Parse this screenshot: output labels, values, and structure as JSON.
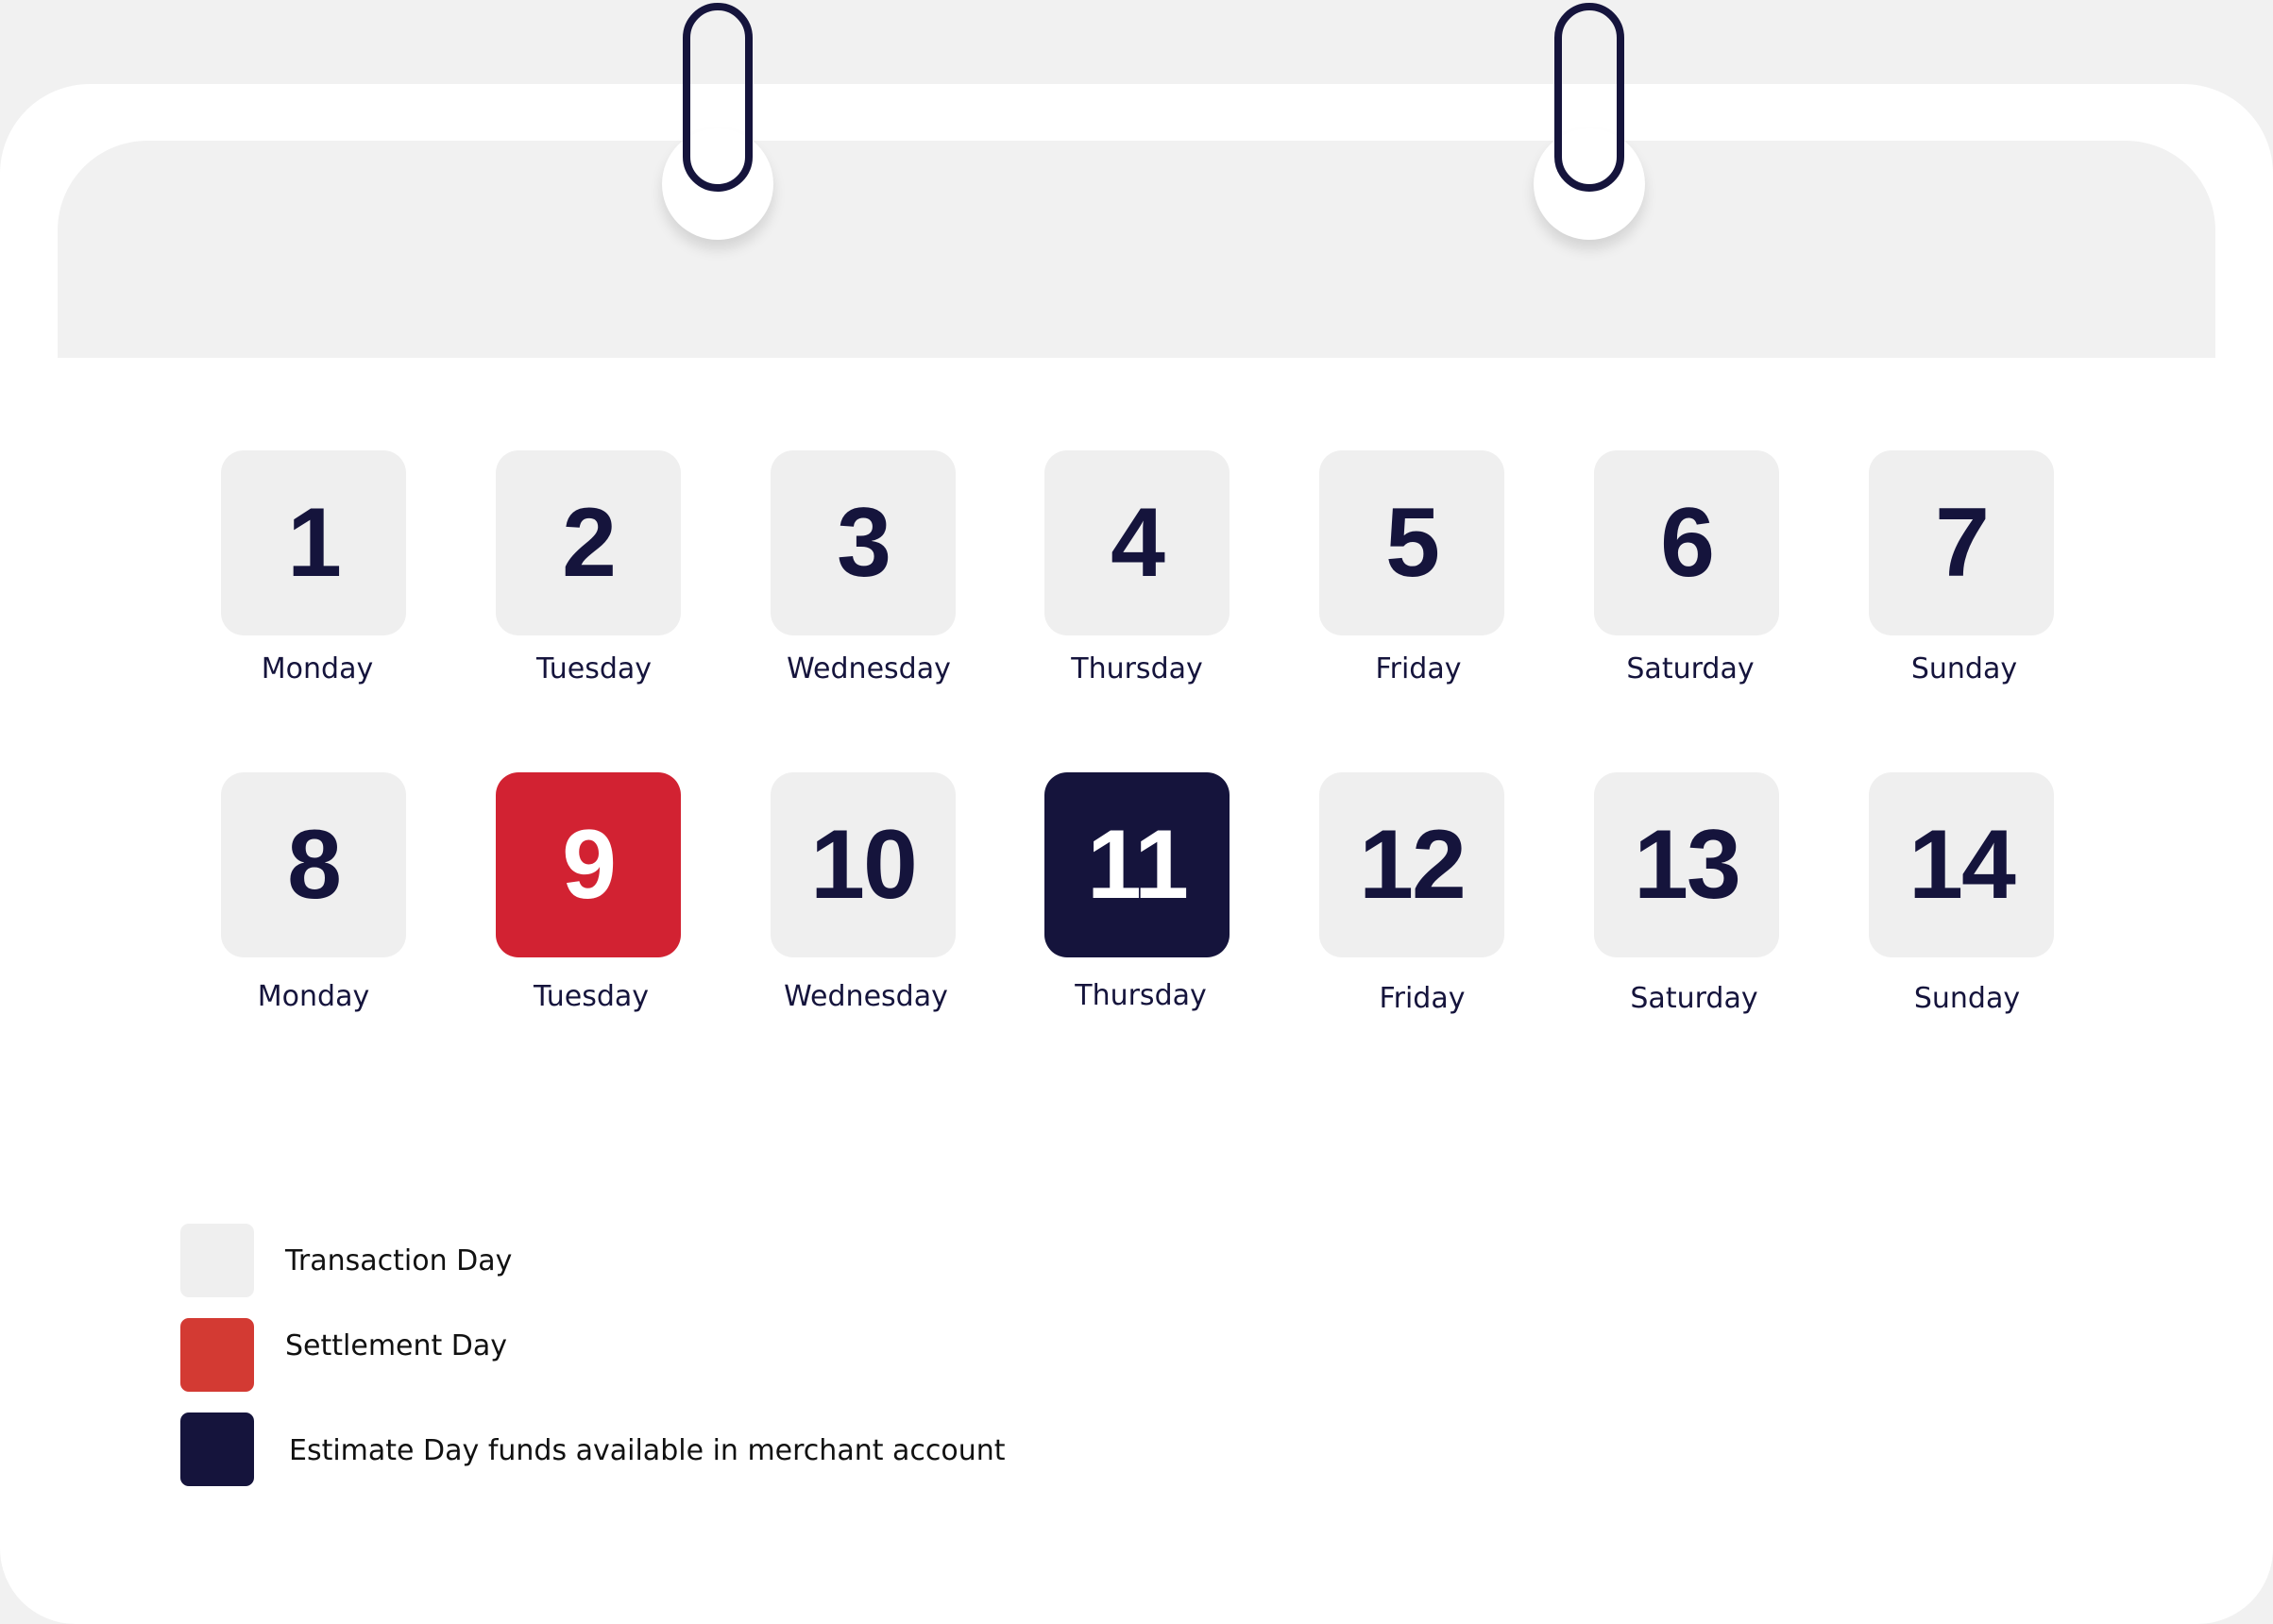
{
  "colors": {
    "background": "#f1f1f1",
    "calendar_body": "#ffffff",
    "transaction": "#efefef",
    "settlement": "#d22232",
    "settlement_swatch": "#d33a33",
    "estimate": "#15143c",
    "text_dark": "#15143c"
  },
  "rings": [
    {
      "icon": "binder-ring-icon"
    },
    {
      "icon": "binder-ring-icon"
    }
  ],
  "weeks": [
    {
      "days": [
        {
          "number": "1",
          "label": "Monday",
          "type": "transaction"
        },
        {
          "number": "2",
          "label": "Tuesday",
          "type": "transaction"
        },
        {
          "number": "3",
          "label": "Wednesday",
          "type": "transaction"
        },
        {
          "number": "4",
          "label": "Thursday",
          "type": "transaction"
        },
        {
          "number": "5",
          "label": "Friday",
          "type": "transaction"
        },
        {
          "number": "6",
          "label": "Saturday",
          "type": "transaction"
        },
        {
          "number": "7",
          "label": "Sunday",
          "type": "transaction"
        }
      ]
    },
    {
      "days": [
        {
          "number": "8",
          "label": "Monday",
          "type": "transaction"
        },
        {
          "number": "9",
          "label": "Tuesday",
          "type": "settlement"
        },
        {
          "number": "10",
          "label": "Wednesday",
          "type": "transaction"
        },
        {
          "number": "11",
          "label": "Thursday",
          "type": "estimate"
        },
        {
          "number": "12",
          "label": "Friday",
          "type": "transaction"
        },
        {
          "number": "13",
          "label": "Saturday",
          "type": "transaction"
        },
        {
          "number": "14",
          "label": "Sunday",
          "type": "transaction"
        }
      ]
    }
  ],
  "legend": {
    "items": [
      {
        "label": "Transaction Day",
        "type": "transaction"
      },
      {
        "label": "Settlement Day",
        "type": "settlement"
      },
      {
        "label": "Estimate Day funds available in merchant account",
        "type": "estimate"
      }
    ]
  }
}
